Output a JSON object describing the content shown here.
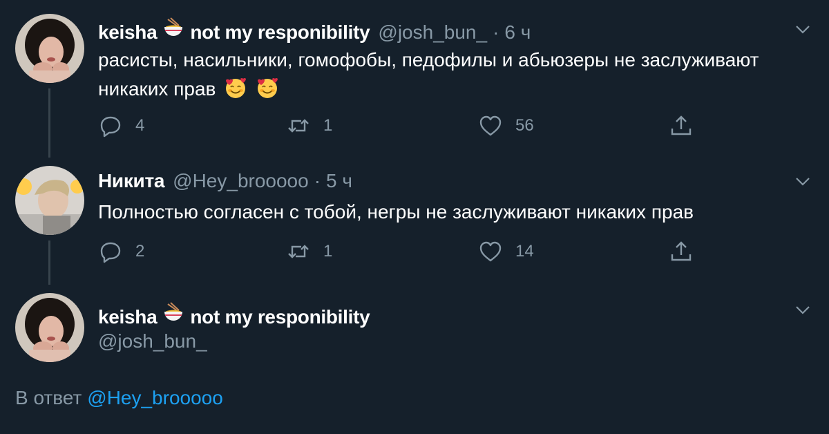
{
  "tweets": [
    {
      "name": "keisha",
      "name_suffix": "not my responibility",
      "handle": "@josh_bun_",
      "time": "6 ч",
      "text_line1": "расисты, насильники, гомофобы, педофилы и абьюзеры не заслуживают",
      "text_line2": "никаких прав",
      "replies": "4",
      "retweets": "1",
      "likes": "56"
    },
    {
      "name": "Никита",
      "handle": "@Hey_brooooo",
      "time": "5 ч",
      "text_line1": "Полностью согласен с тобой, негры не заслуживают никаких прав",
      "replies": "2",
      "retweets": "1",
      "likes": "14"
    },
    {
      "name": "keisha",
      "name_suffix": "not my responibility",
      "handle": "@josh_bun_"
    }
  ],
  "reply_to": {
    "prefix": "В ответ",
    "mention": "@Hey_brooooo"
  },
  "separator": "·",
  "colors": {
    "background": "#15202b",
    "secondary_text": "#8899a6",
    "link": "#1da1f2",
    "thread_line": "#38444d"
  },
  "icons": [
    "reply-icon",
    "retweet-icon",
    "like-icon",
    "share-icon",
    "chevron-down-icon",
    "noodle-bowl-emoji",
    "smiling-face-with-hearts-emoji"
  ]
}
